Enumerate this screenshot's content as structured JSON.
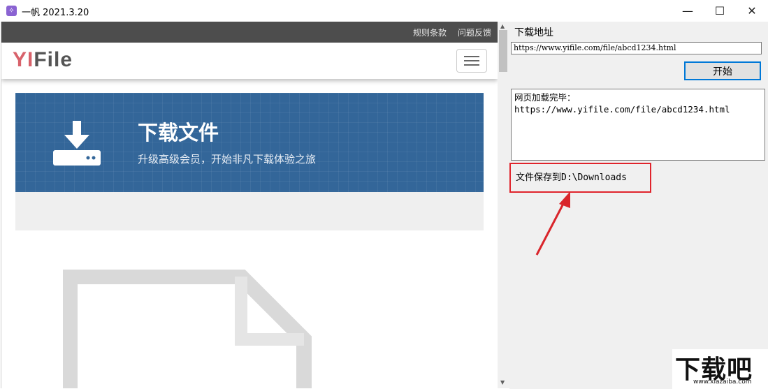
{
  "window": {
    "title": "一帆 2021.3.20",
    "icon": "app-icon",
    "controls": [
      "—",
      "☐",
      "✕"
    ]
  },
  "browser": {
    "top_links": [
      "规则条款",
      "问题反馈"
    ],
    "logo": {
      "yi": "YI",
      "file": "File"
    },
    "banner": {
      "title": "下载文件",
      "subtitle": "升级高级会员，开始非凡下载体验之旅",
      "color": "#336699"
    }
  },
  "panel": {
    "address_label": "下载地址",
    "url_value": "https://www.yifile.com/file/abcd1234.html",
    "start_button": "开始",
    "log_lines": "网页加载完毕：\nhttps://www.yifile.com/file/abcd1234.html",
    "save_path": "文件保存到D:\\Downloads",
    "highlight_color": "#e0242c"
  },
  "watermark": {
    "text": "下载吧",
    "url": "www.xiazaiba.com"
  }
}
